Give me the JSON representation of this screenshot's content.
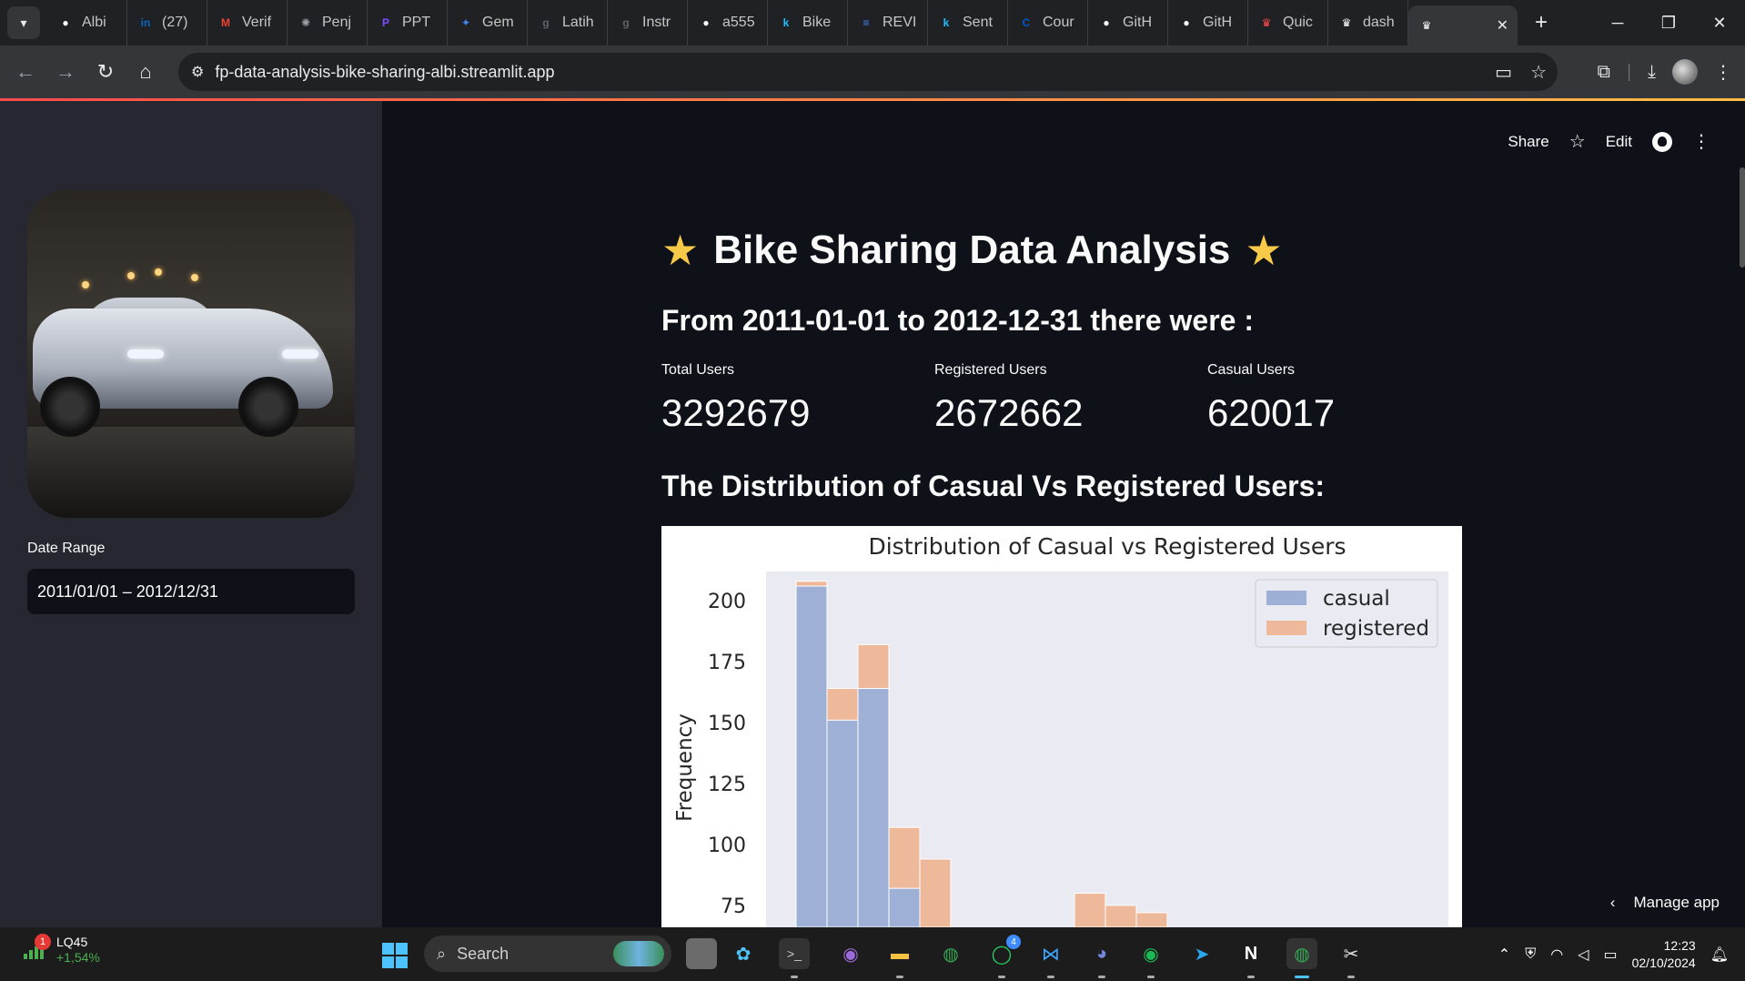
{
  "browser": {
    "tabs": [
      {
        "title": "Albi",
        "icon": "github-icon",
        "color": "#ffffff",
        "glyph": "●"
      },
      {
        "title": "(27)",
        "icon": "linkedin-icon",
        "color": "#0a66c2",
        "glyph": "in"
      },
      {
        "title": "Verif",
        "icon": "gmail-icon",
        "color": "#ea4335",
        "glyph": "M"
      },
      {
        "title": "Penj",
        "icon": "chatgpt-icon",
        "color": "#9aa0a6",
        "glyph": "✺"
      },
      {
        "title": "PPT",
        "icon": "presentation-icon",
        "color": "#7c4dff",
        "glyph": "P"
      },
      {
        "title": "Gem",
        "icon": "gemini-icon",
        "color": "#4285f4",
        "glyph": "✦"
      },
      {
        "title": "Latih",
        "icon": "g-icon",
        "color": "#5f6368",
        "glyph": "g"
      },
      {
        "title": "Instr",
        "icon": "g-icon",
        "color": "#5f6368",
        "glyph": "g"
      },
      {
        "title": "a555",
        "icon": "github-icon",
        "color": "#ffffff",
        "glyph": "●"
      },
      {
        "title": "Bike",
        "icon": "kaggle-icon",
        "color": "#20beff",
        "glyph": "k"
      },
      {
        "title": "REVI",
        "icon": "docs-icon",
        "color": "#4285f4",
        "glyph": "≡"
      },
      {
        "title": "Sent",
        "icon": "kaggle-icon",
        "color": "#20beff",
        "glyph": "k"
      },
      {
        "title": "Cour",
        "icon": "coursera-icon",
        "color": "#0056d2",
        "glyph": "C"
      },
      {
        "title": "GitH",
        "icon": "github-icon",
        "color": "#ffffff",
        "glyph": "●"
      },
      {
        "title": "GitH",
        "icon": "github-icon",
        "color": "#ffffff",
        "glyph": "●"
      },
      {
        "title": "Quic",
        "icon": "streamlit-icon",
        "color": "#ff4b4b",
        "glyph": "♛"
      },
      {
        "title": "dash",
        "icon": "streamlit-icon",
        "color": "#ffffff",
        "glyph": "♛"
      }
    ],
    "active_tab_icon": "streamlit-icon",
    "url": "fp-data-analysis-bike-sharing-albi.streamlit.app"
  },
  "sidebar": {
    "date_label": "Date Range",
    "date_value": "2011/01/01 – 2012/12/31"
  },
  "header": {
    "share": "Share",
    "edit": "Edit"
  },
  "main": {
    "title": "Bike Sharing Data Analysis",
    "subtitle": "From 2011-01-01 to 2012-12-31 there were :",
    "metrics": [
      {
        "label": "Total Users",
        "value": "3292679"
      },
      {
        "label": "Registered Users",
        "value": "2672662"
      },
      {
        "label": "Casual Users",
        "value": "620017"
      }
    ],
    "dist_heading": "The Distribution of Casual Vs Registered Users:",
    "manage_app": "Manage app"
  },
  "chart_data": {
    "type": "bar",
    "title": "Distribution of Casual vs Registered Users",
    "xlabel": "",
    "ylabel": "Frequency",
    "ylim": [
      66,
      212
    ],
    "yticks": [
      75,
      100,
      125,
      150,
      175,
      200
    ],
    "legend_placement": "top-right",
    "grid": false,
    "background": "#eaeaf2",
    "series": [
      {
        "name": "casual",
        "color": "#9fb0d6",
        "bins": [
          {
            "x": 0,
            "y": 206
          },
          {
            "x": 1,
            "y": 151
          },
          {
            "x": 2,
            "y": 164
          },
          {
            "x": 3,
            "y": 82
          }
        ]
      },
      {
        "name": "registered",
        "color": "#eeb99b",
        "bins": [
          {
            "x": 0,
            "y": 208
          },
          {
            "x": 1,
            "y": 164
          },
          {
            "x": 2,
            "y": 182
          },
          {
            "x": 3,
            "y": 107
          },
          {
            "x": 4,
            "y": 94
          },
          {
            "x": 9,
            "y": 80
          },
          {
            "x": 10,
            "y": 75
          },
          {
            "x": 11,
            "y": 72
          }
        ]
      }
    ]
  },
  "taskbar": {
    "stock_name": "LQ45",
    "stock_change": "+1,54%",
    "stock_badge": "1",
    "search_label": "Search",
    "whatsapp_badge": "4",
    "time": "12:23",
    "date": "02/10/2024"
  }
}
